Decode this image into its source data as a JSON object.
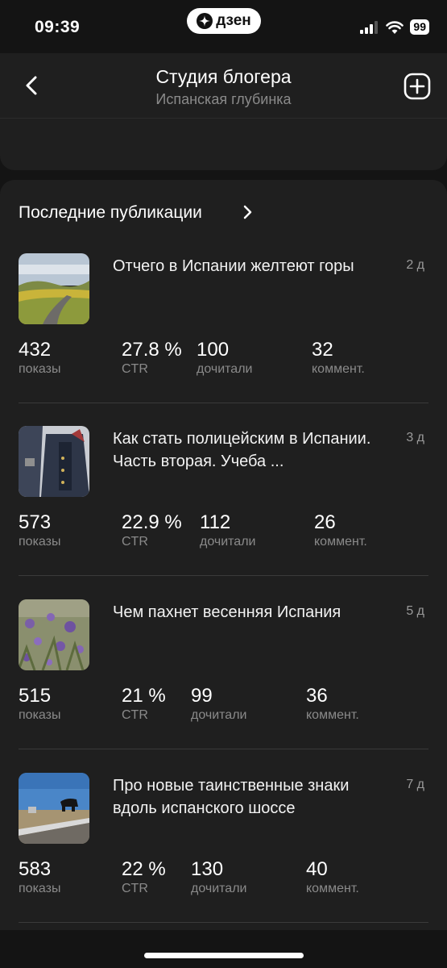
{
  "status_bar": {
    "time": "09:39",
    "brand": "дзен",
    "battery": "99"
  },
  "header": {
    "title": "Студия блогера",
    "subtitle": "Испанская глубинка"
  },
  "section": {
    "title": "Последние публикации"
  },
  "stat_labels": {
    "views": "показы",
    "ctr": "CTR",
    "read": "дочитали",
    "comments": "коммент."
  },
  "publications": [
    {
      "title": "Отчего в Испании желтеют горы",
      "age": "2 д",
      "views": "432",
      "ctr": "27.8 %",
      "read": "100",
      "comments": "32"
    },
    {
      "title": "Как стать полицейским в Испании. Часть вторая. Учеба ...",
      "age": "3 д",
      "views": "573",
      "ctr": "22.9 %",
      "read": "112",
      "comments": "26"
    },
    {
      "title": "Чем пахнет весенняя Испания",
      "age": "5 д",
      "views": "515",
      "ctr": "21 %",
      "read": "99",
      "comments": "36"
    },
    {
      "title": "Про новые таинственные знаки вдоль испанского шоссе",
      "age": "7 д",
      "views": "583",
      "ctr": "22 %",
      "read": "130",
      "comments": "40"
    }
  ],
  "colors": {
    "background": "#141414",
    "card": "#1f1f1f",
    "text_primary": "#ffffff",
    "text_secondary": "#8a8a8a"
  }
}
